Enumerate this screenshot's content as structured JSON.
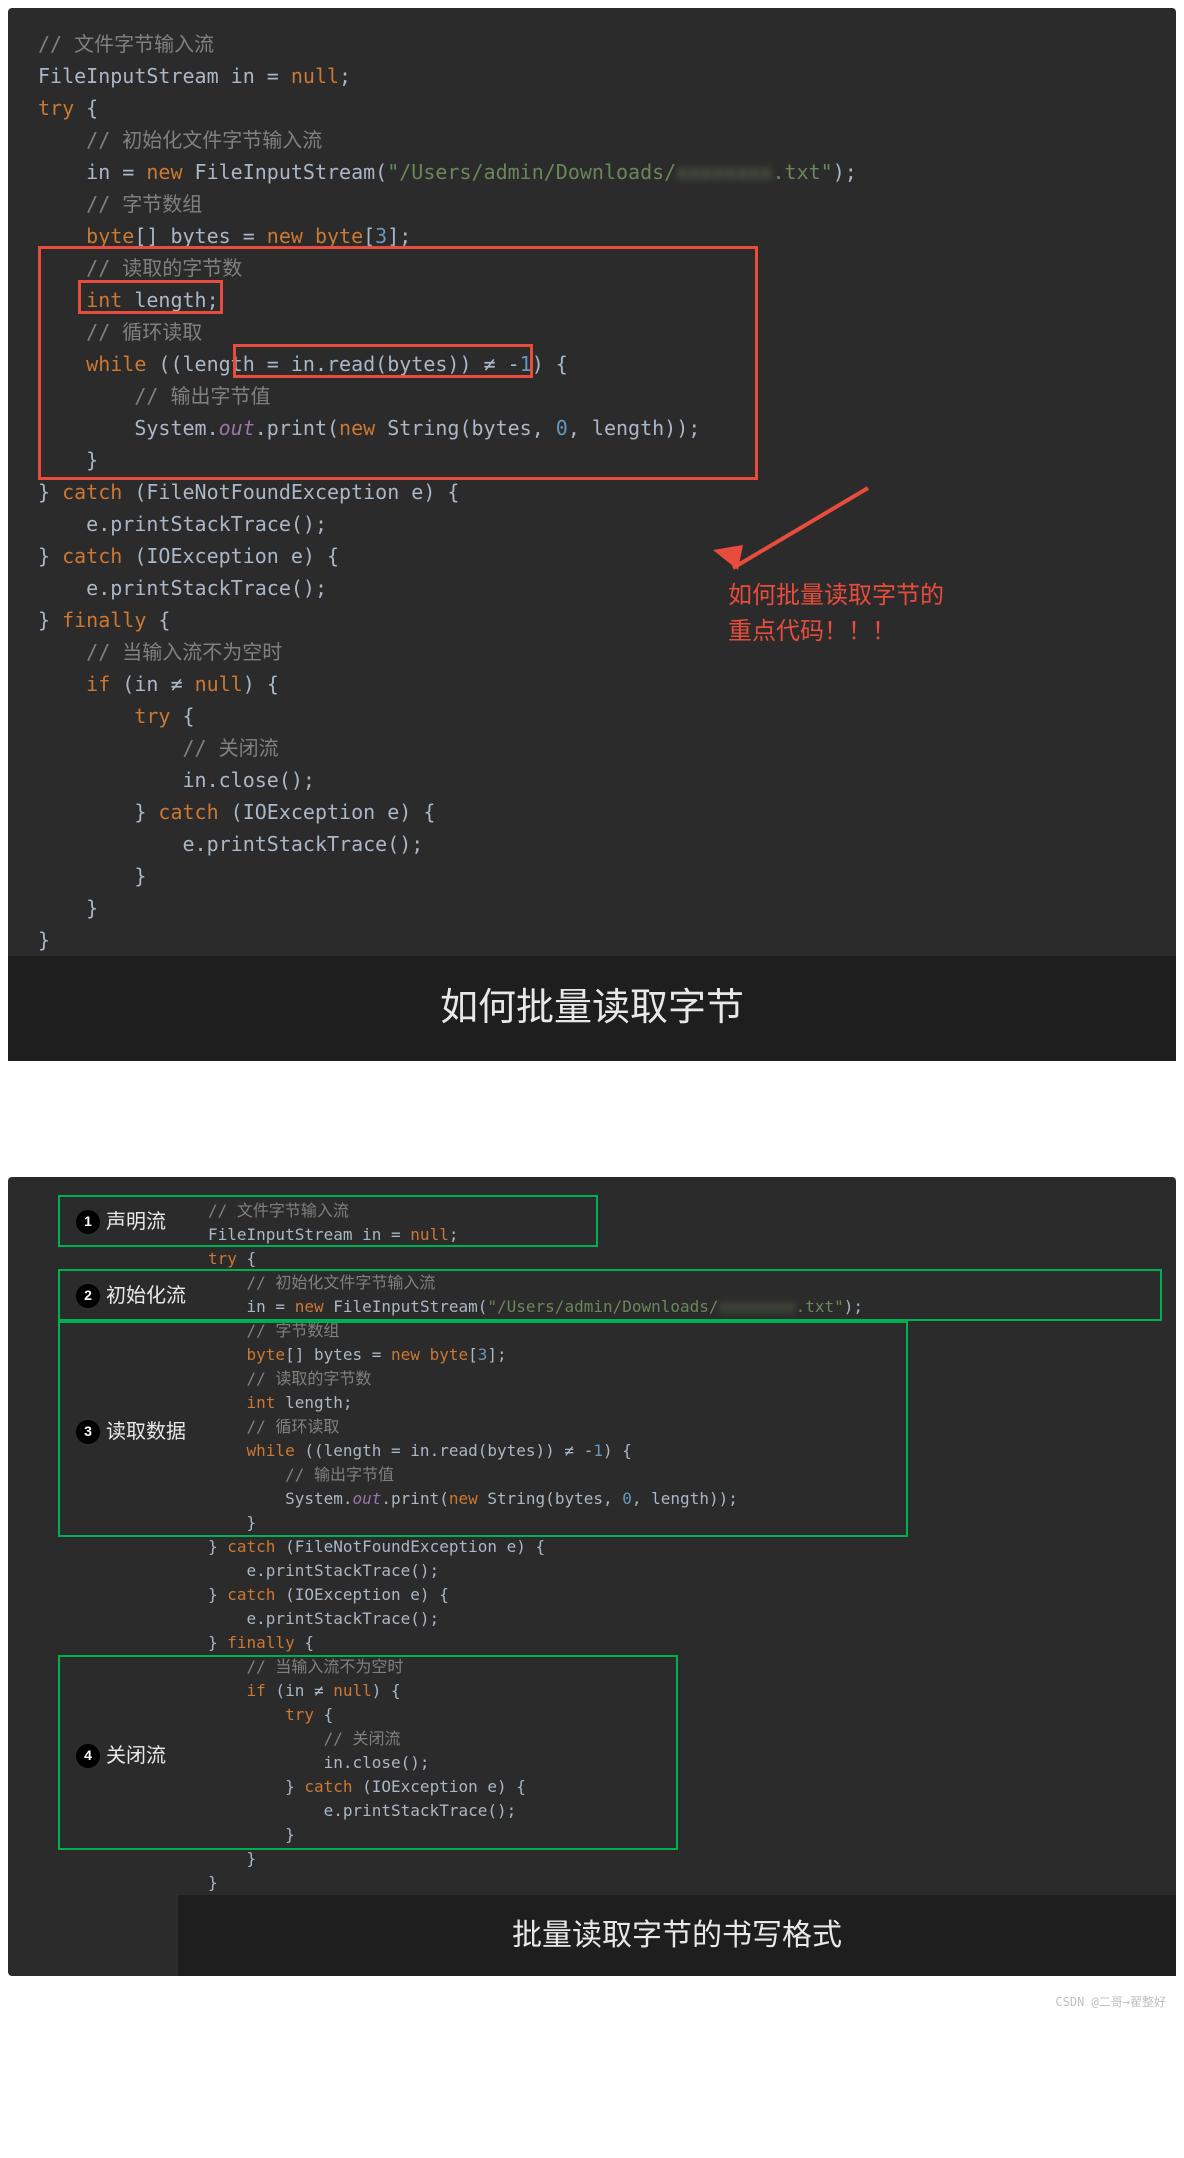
{
  "block1": {
    "title": "如何批量读取字节",
    "code": {
      "l1": "// 文件字节输入流",
      "l2a": "FileInputStream in = ",
      "l2b": "null",
      "l2c": ";",
      "l3": "try",
      "l3b": " {",
      "l4": "    // 初始化文件字节输入流",
      "l5a": "    in = ",
      "l5b": "new",
      "l5c": " FileInputStream(",
      "l5d": "\"/Users/admin/Downloads/",
      "l5e": ".txt\"",
      "l5f": ");",
      "l5blur": "xxxxxxxx",
      "l6": "    // 字节数组",
      "l7a": "    ",
      "l7b": "byte",
      "l7c": "[] bytes = ",
      "l7d": "new byte",
      "l7e": "[",
      "l7f": "3",
      "l7g": "];",
      "l8": "    // 读取的字节数",
      "l9a": "    ",
      "l9b": "int",
      "l9c": " length;",
      "l10": "    // 循环读取",
      "l11a": "    ",
      "l11b": "while",
      "l11c": " ((length = in.read(bytes)) ≠ -",
      "l11d": "1",
      "l11e": ") {",
      "l12": "        // 输出字节值",
      "l13a": "        System.",
      "l13b": "out",
      "l13c": ".print(",
      "l13d": "new",
      "l13e": " String(bytes, ",
      "l13f": "0",
      "l13g": ", length));",
      "l14": "    }",
      "l15a": "} ",
      "l15b": "catch",
      "l15c": " (FileNotFoundException e) {",
      "l16": "    e.printStackTrace();",
      "l17a": "} ",
      "l17b": "catch",
      "l17c": " (IOException e) {",
      "l18": "    e.printStackTrace();",
      "l19a": "} ",
      "l19b": "finally",
      "l19c": " {",
      "l20": "    // 当输入流不为空时",
      "l21a": "    ",
      "l21b": "if",
      "l21c": " (in ≠ ",
      "l21d": "null",
      "l21e": ") {",
      "l22a": "        ",
      "l22b": "try",
      "l22c": " {",
      "l23": "            // 关闭流",
      "l24": "            in.close();",
      "l25a": "        } ",
      "l25b": "catch",
      "l25c": " (IOException e) {",
      "l26": "            e.printStackTrace();",
      "l27": "        }",
      "l28": "    }",
      "l29": "}"
    },
    "annotation": "如何批量读取字节的\n重点代码！！！"
  },
  "block2": {
    "title": "批量读取字节的书写格式",
    "steps": {
      "s1": "声明流",
      "s2": "初始化流",
      "s3": "读取数据",
      "s4": "关闭流"
    }
  },
  "watermark": "CSDN @二哥→翟整好"
}
